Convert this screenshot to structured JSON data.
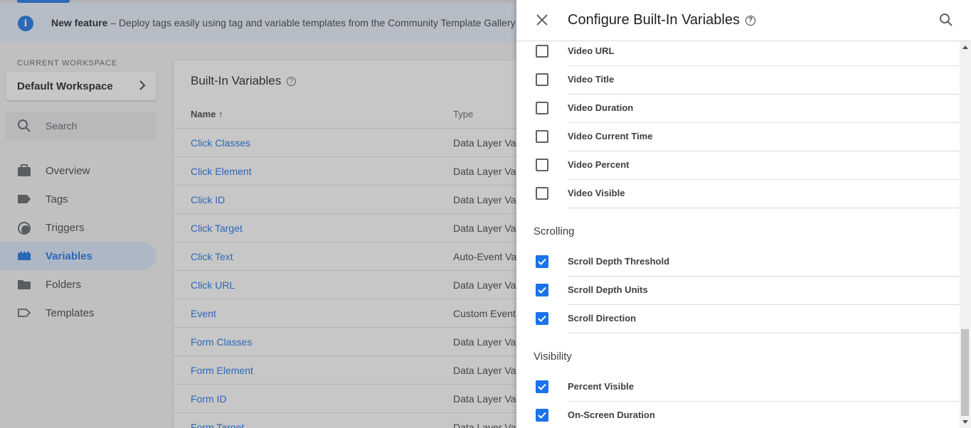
{
  "banner": {
    "bold": "New feature",
    "text": " – Deploy tags easily using tag and variable templates from the Community Template Gallery"
  },
  "sidebar": {
    "workspace_label": "CURRENT WORKSPACE",
    "workspace_name": "Default Workspace",
    "search_placeholder": "Search",
    "items": [
      {
        "label": "Overview",
        "icon": "briefcase-icon"
      },
      {
        "label": "Tags",
        "icon": "tag-icon"
      },
      {
        "label": "Triggers",
        "icon": "trigger-icon"
      },
      {
        "label": "Variables",
        "icon": "variables-icon",
        "active": true
      },
      {
        "label": "Folders",
        "icon": "folder-icon"
      },
      {
        "label": "Templates",
        "icon": "template-icon"
      }
    ]
  },
  "main": {
    "title": "Built-In Variables",
    "col_name": "Name ↑",
    "col_type": "Type",
    "rows": [
      {
        "name": "Click Classes",
        "type": "Data Layer Vari"
      },
      {
        "name": "Click Element",
        "type": "Data Layer Vari"
      },
      {
        "name": "Click ID",
        "type": "Data Layer Vari"
      },
      {
        "name": "Click Target",
        "type": "Data Layer Vari"
      },
      {
        "name": "Click Text",
        "type": "Auto-Event Var"
      },
      {
        "name": "Click URL",
        "type": "Data Layer Vari"
      },
      {
        "name": "Event",
        "type": "Custom Event"
      },
      {
        "name": "Form Classes",
        "type": "Data Layer Vari"
      },
      {
        "name": "Form Element",
        "type": "Data Layer Vari"
      },
      {
        "name": "Form ID",
        "type": "Data Layer Vari"
      },
      {
        "name": "Form Target",
        "type": "Data Layer Vari"
      }
    ]
  },
  "panel": {
    "title": "Configure Built-In Variables",
    "video_items": [
      {
        "label": "Video URL",
        "checked": false
      },
      {
        "label": "Video Title",
        "checked": false
      },
      {
        "label": "Video Duration",
        "checked": false
      },
      {
        "label": "Video Current Time",
        "checked": false
      },
      {
        "label": "Video Percent",
        "checked": false
      },
      {
        "label": "Video Visible",
        "checked": false
      }
    ],
    "scrolling_heading": "Scrolling",
    "scrolling_items": [
      {
        "label": "Scroll Depth Threshold",
        "checked": true
      },
      {
        "label": "Scroll Depth Units",
        "checked": true
      },
      {
        "label": "Scroll Direction",
        "checked": true
      }
    ],
    "visibility_heading": "Visibility",
    "visibility_items": [
      {
        "label": "Percent Visible",
        "checked": true
      },
      {
        "label": "On-Screen Duration",
        "checked": true
      }
    ]
  },
  "colors": {
    "accent": "#1a73e8"
  }
}
